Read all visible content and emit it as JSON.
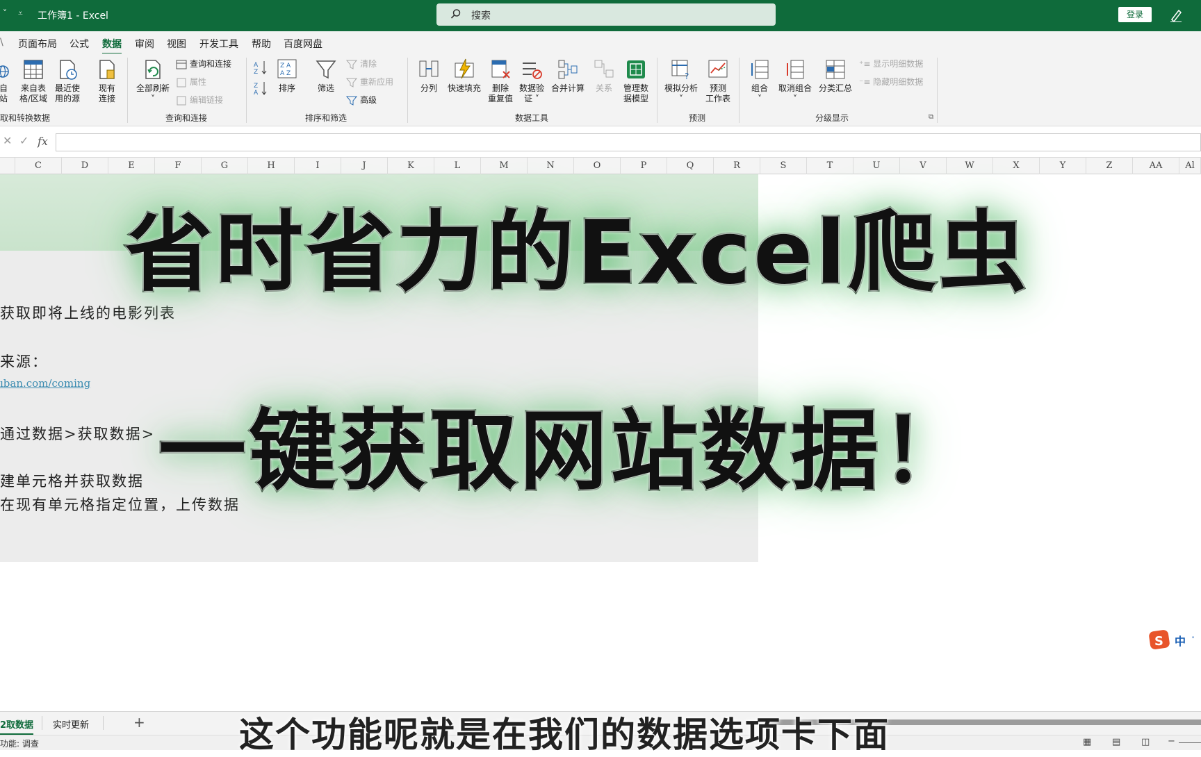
{
  "window": {
    "qa_left": "˅",
    "qa_more": "⩡",
    "doc_title": "工作簿1 - Excel",
    "search_label": "搜索",
    "login_label": "登录"
  },
  "menu_tabs": [
    "页面布局",
    "公式",
    "数据",
    "审阅",
    "视图",
    "开发工具",
    "帮助",
    "百度网盘"
  ],
  "active_tab": "数据",
  "ribbon": {
    "get_data": {
      "web_label_1": "自",
      "web_label_2": "站",
      "from_table_1": "来自表",
      "from_table_2": "格/区域",
      "recent_1": "最近使",
      "recent_2": "用的源",
      "existing_1": "现有",
      "existing_2": "连接",
      "group_label": "取和转换数据"
    },
    "queries": {
      "refresh_all": "全部刷新",
      "queries_connections": "查询和连接",
      "properties": "属性",
      "edit_links": "编辑链接",
      "group_label": "查询和连接"
    },
    "sort_filter": {
      "sort": "排序",
      "filter": "筛选",
      "clear": "清除",
      "reapply": "重新应用",
      "advanced": "高级",
      "group_label": "排序和筛选"
    },
    "data_tools": {
      "text_to_columns": "分列",
      "flash_fill": "快速填充",
      "remove_dup_1": "删除",
      "remove_dup_2": "重复值",
      "validation_1": "数据验",
      "validation_2": "证",
      "consolidate": "合并计算",
      "relationships": "关系",
      "data_model_1": "管理数",
      "data_model_2": "据模型",
      "group_label": "数据工具"
    },
    "forecast": {
      "what_if": "模拟分析",
      "forecast_1": "预测",
      "forecast_2": "工作表",
      "group_label": "预测"
    },
    "outline": {
      "group": "组合",
      "ungroup": "取消组合",
      "subtotal": "分类汇总",
      "show_detail": "显示明细数据",
      "hide_detail": "隐藏明细数据",
      "group_label": "分级显示"
    }
  },
  "formula_bar": {
    "fx": "fx",
    "value": ""
  },
  "columns": [
    "C",
    "D",
    "E",
    "F",
    "G",
    "H",
    "I",
    "J",
    "K",
    "L",
    "M",
    "N",
    "O",
    "P",
    "Q",
    "R",
    "S",
    "T",
    "U",
    "V",
    "W",
    "X",
    "Y",
    "Z",
    "AA",
    "Al"
  ],
  "cells": {
    "line1": "获取即将上线的电影列表",
    "line2": "来源：",
    "link": "ıban.com/coming",
    "line3": "通过数据>获取数据>",
    "line4": "建单元格并获取数据",
    "line5": "在现有单元格指定位置，上传数据"
  },
  "overlay": {
    "title_1": "省时省力的Excel爬虫",
    "title_2": "一键获取网站数据！"
  },
  "ime": {
    "label": "中"
  },
  "sheet_tabs": [
    "2取数据",
    "实时更新"
  ],
  "add_sheet": "+",
  "status": {
    "text": "功能: 调查"
  },
  "subtitle": "这个功能呢就是在我们的数据选项卡下面",
  "colors": {
    "brand": "#0f6b3b",
    "glow": "#6ec27f"
  }
}
